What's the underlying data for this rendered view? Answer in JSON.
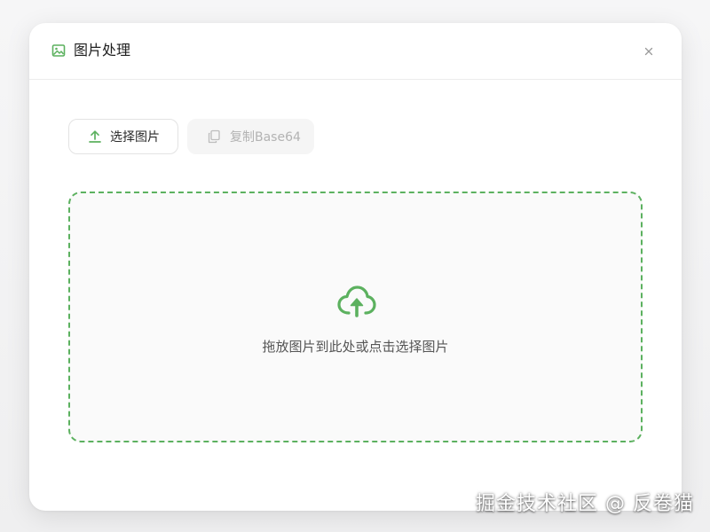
{
  "dialog": {
    "title": "图片处理",
    "title_icon": "image-icon",
    "close_icon": "close-icon",
    "close_glyph": "×"
  },
  "toolbar": {
    "select_label": "选择图片",
    "select_icon": "upload-icon",
    "copy_label": "复制Base64",
    "copy_icon": "copy-icon",
    "copy_disabled": true
  },
  "dropzone": {
    "icon": "cloud-upload-icon",
    "hint": "拖放图片到此处或点击选择图片"
  },
  "watermark": {
    "text": "掘金技术社区 @ 反卷猫"
  },
  "colors": {
    "accent": "#5cb15f",
    "text_primary": "#1f1f1f",
    "text_muted": "#555555",
    "disabled": "#b3b3b3",
    "dropzone_bg": "#fafafa"
  }
}
